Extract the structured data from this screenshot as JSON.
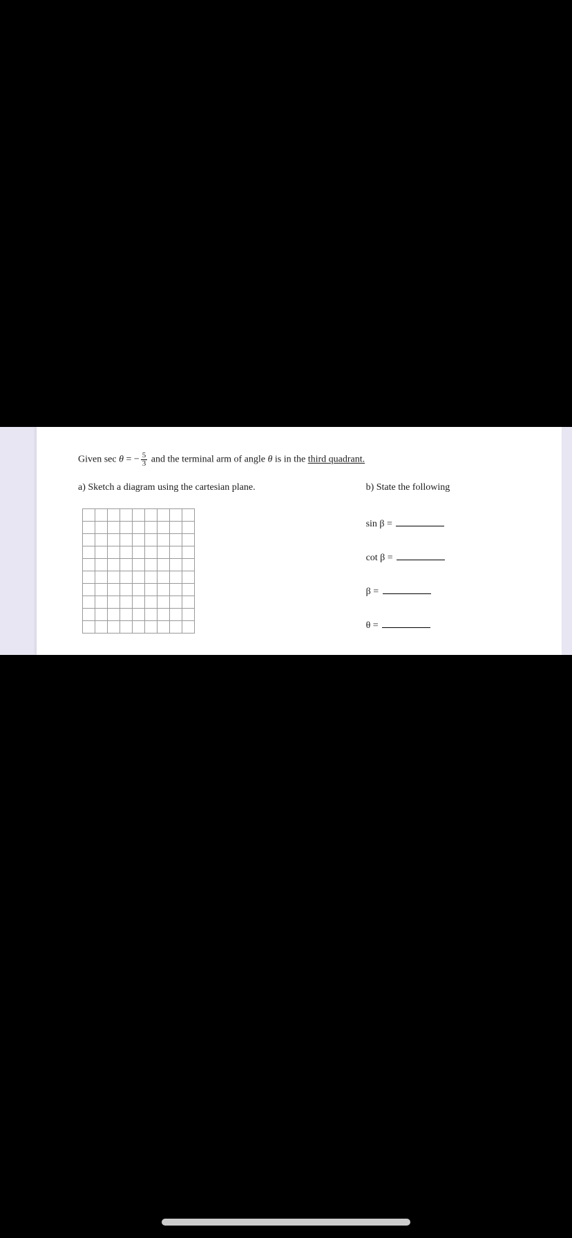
{
  "problem": {
    "given_prefix": "Given sec ",
    "theta": "θ",
    "equals": " = −",
    "frac_num": "5",
    "frac_den": "3",
    "given_suffix_1": " and the terminal arm of angle ",
    "given_suffix_2": " is in the ",
    "underlined": "third quadrant."
  },
  "partA": {
    "label": "a) Sketch a diagram using the cartesian plane.",
    "grid_rows": 10,
    "grid_cols": 9
  },
  "partB": {
    "label": "b) State the following",
    "lines": [
      {
        "label": "sin β ="
      },
      {
        "label": "cot β ="
      },
      {
        "label": "β ="
      },
      {
        "label": "θ ="
      }
    ]
  }
}
